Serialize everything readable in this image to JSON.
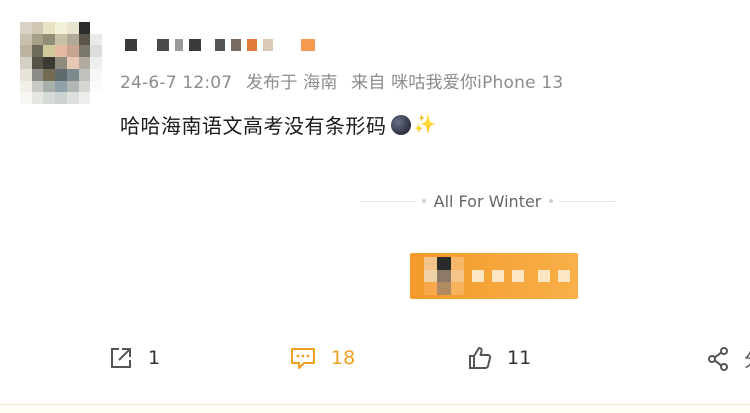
{
  "post": {
    "meta": {
      "time": "24-6-7 12:07",
      "location": "发布于 海南",
      "source": "来自 咪咕我爱你iPhone 13"
    },
    "text": "哈哈海南语文高考没有条形码"
  },
  "divider": {
    "label": "All For Winter"
  },
  "actions": {
    "share_count": "1",
    "comment_count": "18",
    "like_count": "11",
    "more_label": "分"
  },
  "colors": {
    "accent": "#f39a2a",
    "comment_icon": "#f0a020",
    "meta_text": "#8c8c8c"
  }
}
